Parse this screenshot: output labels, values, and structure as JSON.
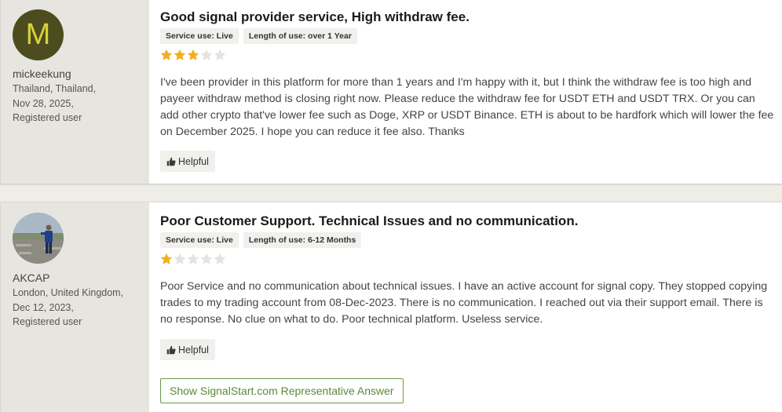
{
  "reviews": [
    {
      "avatar_letter": "M",
      "username": "mickeekung",
      "location": "Thailand, Thailand,",
      "date": "Nov 28, 2025,",
      "user_type": "Registered user",
      "title": "Good signal provider service, High withdraw fee.",
      "badges": [
        "Service use: Live",
        "Length of use: over 1 Year"
      ],
      "rating": 3,
      "rating_max": 5,
      "body": "I've been provider in this platform for more than 1 years and I'm happy with it, but I think the withdraw fee is too high and payeer withdraw method is closing right now. Please reduce the withdraw fee for USDT ETH and USDT TRX. Or you can add other crypto that've lower fee such as Doge, XRP or USDT Binance. ETH is about to be hardfork which will lower the fee on December 2025. I hope you can reduce it fee also. Thanks",
      "helpful_label": "Helpful"
    },
    {
      "username": "AKCAP",
      "location": "London, United Kingdom,",
      "date": "Dec 12, 2023,",
      "user_type": "Registered user",
      "title": "Poor Customer Support. Technical Issues and no communication.",
      "badges": [
        "Service use: Live",
        "Length of use: 6-12 Months"
      ],
      "rating": 1,
      "rating_max": 5,
      "body": "Poor Service and no communication about technical issues. I have an active account for signal copy. They stopped copying trades to my trading account from 08-Dec-2023. There is no communication. I reached out via their support email. There is no response. No clue on what to do. Poor technical platform. Useless service.",
      "helpful_label": "Helpful",
      "rep_answer_label": "Show SignalStart.com Representative Answer"
    }
  ],
  "colors": {
    "star_filled": "#f2b01e",
    "star_empty": "#e4e3df",
    "accent_green": "#5a8a38",
    "avatar_m_bg": "#4c4c1e",
    "avatar_m_letter": "#d8d23a"
  },
  "icons": {
    "star": "star-icon",
    "thumbs_up": "thumbs-up-icon"
  }
}
